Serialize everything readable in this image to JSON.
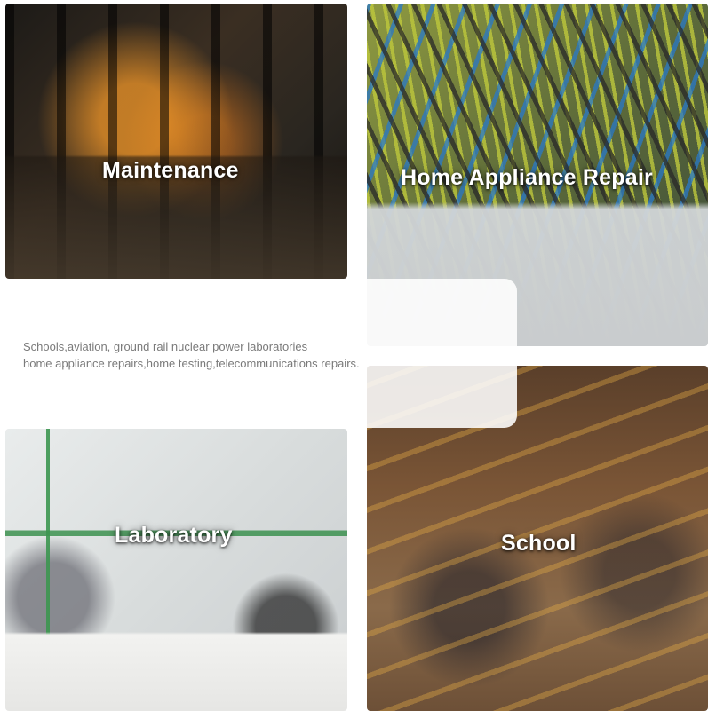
{
  "tiles": {
    "maintenance": {
      "label": "Maintenance"
    },
    "home_appliance_repair": {
      "label": "Home Appliance Repair"
    },
    "laboratory": {
      "label": "Laboratory"
    },
    "school": {
      "label": "School"
    }
  },
  "info": {
    "line1": "Schools,aviation, ground rail nuclear power laboratories",
    "line2": "home appliance repairs,home testing,telecommunications repairs."
  }
}
